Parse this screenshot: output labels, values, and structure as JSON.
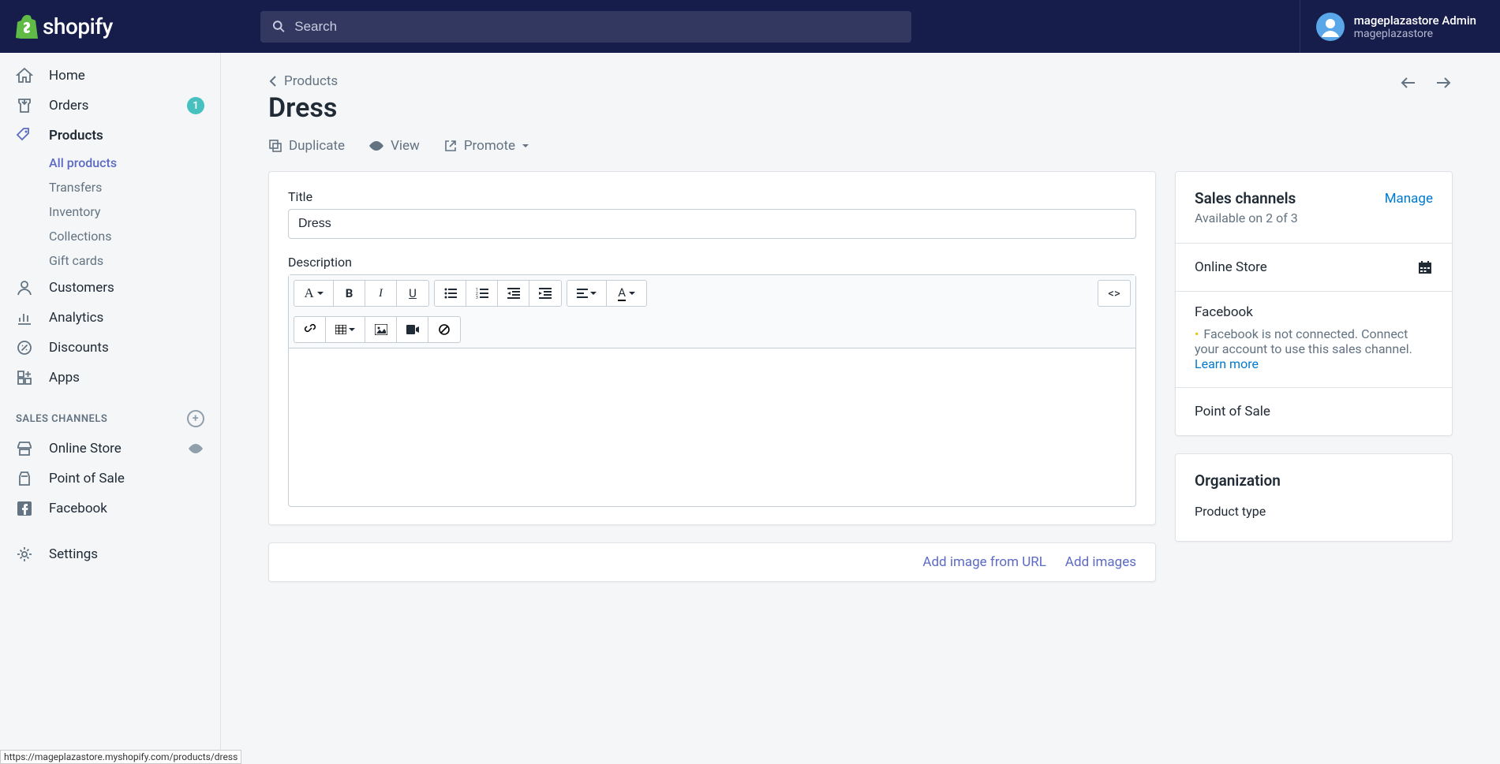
{
  "topbar": {
    "logo_text": "shopify",
    "search_placeholder": "Search",
    "user_name": "mageplazastore Admin",
    "store_name": "mageplazastore"
  },
  "sidebar": {
    "home": "Home",
    "orders": "Orders",
    "orders_badge": "1",
    "products": "Products",
    "sub": {
      "all_products": "All products",
      "transfers": "Transfers",
      "inventory": "Inventory",
      "collections": "Collections",
      "gift_cards": "Gift cards"
    },
    "customers": "Customers",
    "analytics": "Analytics",
    "discounts": "Discounts",
    "apps": "Apps",
    "sales_channels_heading": "SALES CHANNELS",
    "online_store": "Online Store",
    "pos": "Point of Sale",
    "facebook": "Facebook",
    "settings": "Settings"
  },
  "header": {
    "breadcrumb": "Products",
    "title": "Dress",
    "actions": {
      "duplicate": "Duplicate",
      "view": "View",
      "promote": "Promote"
    }
  },
  "form": {
    "title_label": "Title",
    "title_value": "Dress",
    "description_label": "Description"
  },
  "images": {
    "add_from_url": "Add image from URL",
    "add_images": "Add images"
  },
  "sales_channels": {
    "heading": "Sales channels",
    "manage": "Manage",
    "availability": "Available on 2 of 3",
    "online_store": "Online Store",
    "facebook": "Facebook",
    "facebook_warn": "Facebook is not connected. Connect your account to use this sales channel. ",
    "learn_more": "Learn more",
    "pos": "Point of Sale"
  },
  "organization": {
    "heading": "Organization",
    "product_type": "Product type"
  },
  "status_url": "https://mageplazastore.myshopify.com/products/dress"
}
